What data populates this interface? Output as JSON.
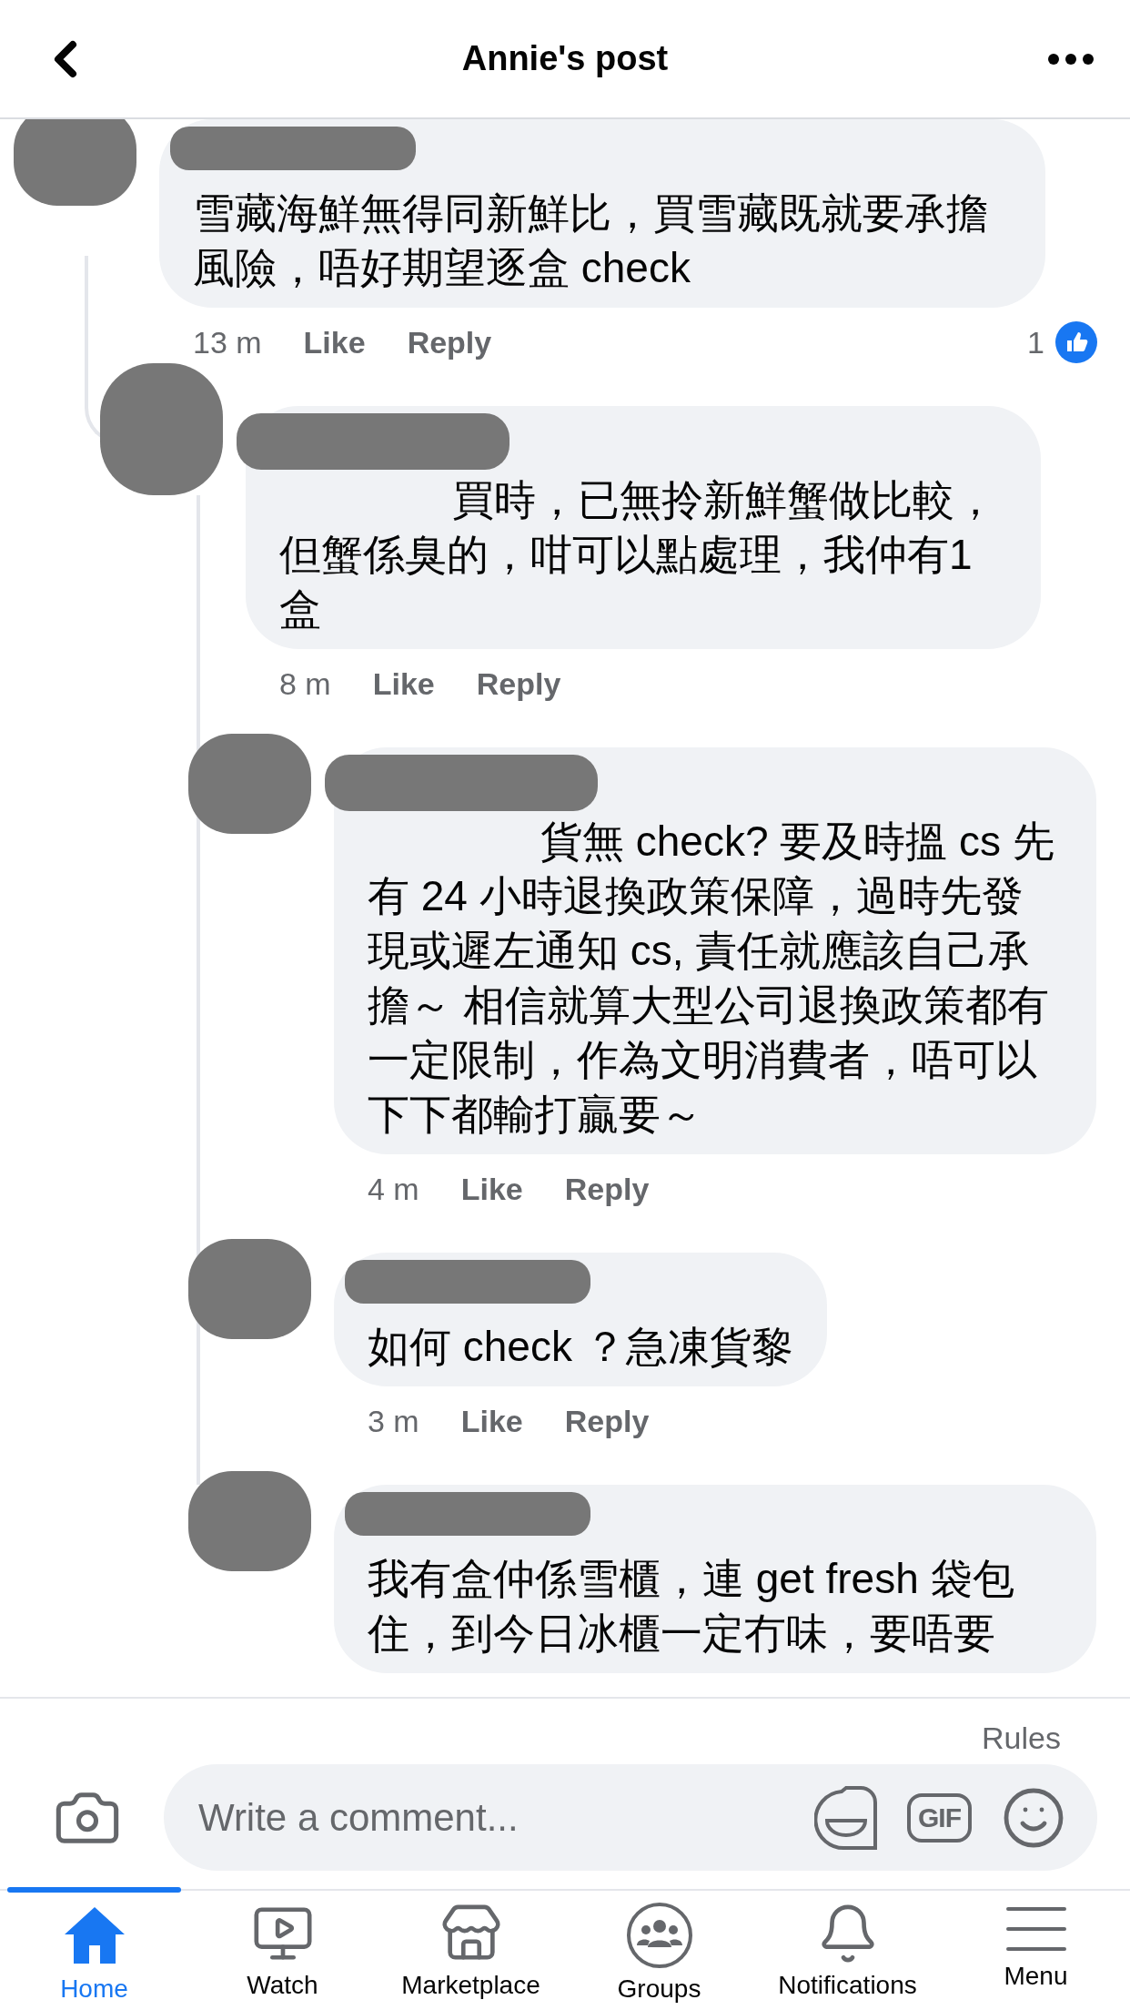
{
  "header": {
    "title": "Annie's post"
  },
  "comments": [
    {
      "text": "雪藏海鮮無得同新鮮比，買雪藏既就要承擔風險，唔好期望逐盒 check",
      "redacted_start": false,
      "time": "13 m",
      "like": "Like",
      "reply": "Reply",
      "reaction_count": "1",
      "children": [
        {
          "text": "買時，已無拎新鮮蟹做比較，但蟹係臭的，咁可以點處理，我仲有1盒",
          "redacted_start": true,
          "time": "8 m",
          "like": "Like",
          "reply": "Reply",
          "children": [
            {
              "text": "貨無 check? 要及時搵 cs 先有 24 小時退換政策保障，過時先發現或遲左通知 cs, 責任就應該自己承擔～ 相信就算大型公司退換政策都有一定限制，作為文明消費者，唔可以下下都輸打贏要～",
              "redacted_start": true,
              "time": "4 m",
              "like": "Like",
              "reply": "Reply"
            },
            {
              "text": "如何 check ？急凍貨黎",
              "redacted_start": false,
              "time": "3 m",
              "like": "Like",
              "reply": "Reply"
            },
            {
              "text": "我有盒仲係雪櫃，連 get fresh 袋包住，到今日冰櫃一定冇味，要唔要",
              "redacted_start": false
            }
          ]
        }
      ]
    }
  ],
  "rules": "Rules",
  "composer": {
    "placeholder": "Write a comment...",
    "gif_label": "GIF"
  },
  "tabs": [
    {
      "label": "Home",
      "selected": true
    },
    {
      "label": "Watch",
      "selected": false
    },
    {
      "label": "Marketplace",
      "selected": false
    },
    {
      "label": "Groups",
      "selected": false
    },
    {
      "label": "Notifications",
      "selected": false
    },
    {
      "label": "Menu",
      "selected": false
    }
  ]
}
